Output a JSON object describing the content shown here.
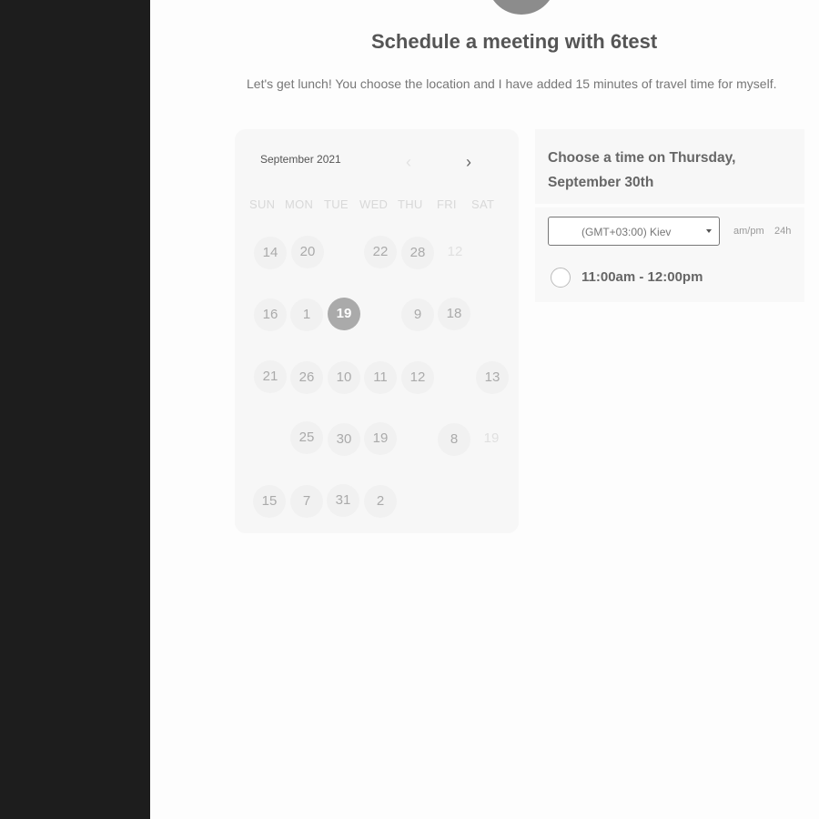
{
  "page": {
    "title": "Schedule a meeting with 6test",
    "description": "Let's get lunch! You choose the location and I have added 15 minutes of travel time for myself."
  },
  "calendar": {
    "month_label": "September 2021",
    "prev_icon": "‹",
    "next_icon": "›",
    "weekdays": [
      "SUN",
      "MON",
      "TUE",
      "WED",
      "THU",
      "FRI",
      "SAT"
    ],
    "days": [
      {
        "label": "14"
      },
      {
        "label": "20"
      },
      {
        "label": "22"
      },
      {
        "label": "28"
      },
      {
        "label": "12"
      },
      {
        "label": "16"
      },
      {
        "label": "1"
      },
      {
        "label": "19"
      },
      {
        "label": "9"
      },
      {
        "label": "18"
      },
      {
        "label": "21"
      },
      {
        "label": "26"
      },
      {
        "label": "10"
      },
      {
        "label": "11"
      },
      {
        "label": "12"
      },
      {
        "label": "13"
      },
      {
        "label": "25"
      },
      {
        "label": "30"
      },
      {
        "label": "19"
      },
      {
        "label": "8"
      },
      {
        "label": "19"
      },
      {
        "label": "15"
      },
      {
        "label": "7"
      },
      {
        "label": "31"
      },
      {
        "label": "2"
      }
    ]
  },
  "time_panel": {
    "heading": "Choose a time on Thursday, September 30th",
    "timezone": "(GMT+03:00) Kiev",
    "format_ampm": "am/pm",
    "format_24h": "24h",
    "slots": [
      {
        "label": "11:00am - 12:00pm"
      }
    ]
  },
  "colors": {
    "sidebar": "#1d1d1d",
    "selected_day": "#aaaaaa",
    "background": "#fdfdfd"
  }
}
